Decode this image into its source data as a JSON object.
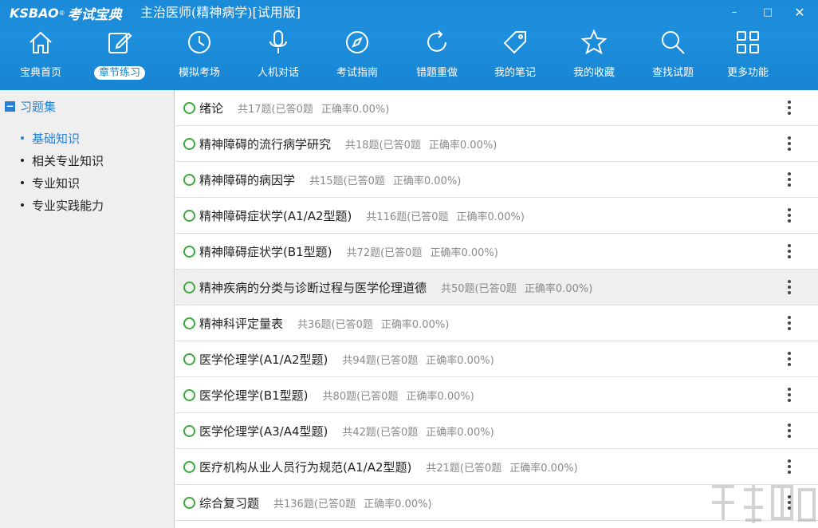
{
  "header": {
    "logo_latin": "KSBAO",
    "logo_reg": "®",
    "logo_cn": "考试宝典",
    "title": "主治医师(精神病学)[试用版]",
    "colors": {
      "bar": "#1684d2",
      "text": "#ffffff"
    }
  },
  "window_controls": {
    "minimize": "–",
    "maximize": "□",
    "close": "✕"
  },
  "nav": [
    {
      "label": "宝典首页",
      "icon": "home-icon"
    },
    {
      "label": "章节练习",
      "icon": "edit-icon",
      "active": true
    },
    {
      "label": "模拟考场",
      "icon": "clock-icon"
    },
    {
      "label": "人机对话",
      "icon": "microphone-icon"
    },
    {
      "label": "考试指南",
      "icon": "compass-icon"
    },
    {
      "label": "错题重做",
      "icon": "refresh-icon"
    },
    {
      "label": "我的笔记",
      "icon": "tag-icon"
    },
    {
      "label": "我的收藏",
      "icon": "star-icon"
    },
    {
      "label": "查找试题",
      "icon": "search-icon"
    },
    {
      "label": "更多功能",
      "icon": "grid-icon"
    }
  ],
  "sidebar": {
    "root_toggle": "−",
    "root_label": "习题集",
    "items": [
      {
        "label": "基础知识",
        "active": true
      },
      {
        "label": "相关专业知识"
      },
      {
        "label": "专业知识"
      },
      {
        "label": "专业实践能力"
      }
    ]
  },
  "chapters": [
    {
      "title": "绪论",
      "meta": "共17题(已答0题",
      "accuracy": "正确率0.00%)"
    },
    {
      "title": "精神障碍的流行病学研究",
      "meta": "共18题(已答0题",
      "accuracy": "正确率0.00%)"
    },
    {
      "title": "精神障碍的病因学",
      "meta": "共15题(已答0题",
      "accuracy": "正确率0.00%)"
    },
    {
      "title": "精神障碍症状学(A1/A2型题)",
      "meta": "共116题(已答0题",
      "accuracy": "正确率0.00%)"
    },
    {
      "title": "精神障碍症状学(B1型题)",
      "meta": "共72题(已答0题",
      "accuracy": "正确率0.00%)"
    },
    {
      "title": "精神疾病的分类与诊断过程与医学伦理道德",
      "meta": "共50题(已答0题",
      "accuracy": "正确率0.00%)",
      "highlighted": true
    },
    {
      "title": "精神科评定量表",
      "meta": "共36题(已答0题",
      "accuracy": "正确率0.00%)"
    },
    {
      "title": "医学伦理学(A1/A2型题)",
      "meta": "共94题(已答0题",
      "accuracy": "正确率0.00%)"
    },
    {
      "title": "医学伦理学(B1型题)",
      "meta": "共80题(已答0题",
      "accuracy": "正确率0.00%)"
    },
    {
      "title": "医学伦理学(A3/A4型题)",
      "meta": "共42题(已答0题",
      "accuracy": "正确率0.00%)"
    },
    {
      "title": "医疗机构从业人员行为规范(A1/A2型题)",
      "meta": "共21题(已答0题",
      "accuracy": "正确率0.00%)"
    },
    {
      "title": "综合复习题",
      "meta": "共136题(已答0题",
      "accuracy": "正确率0.00%)"
    }
  ]
}
